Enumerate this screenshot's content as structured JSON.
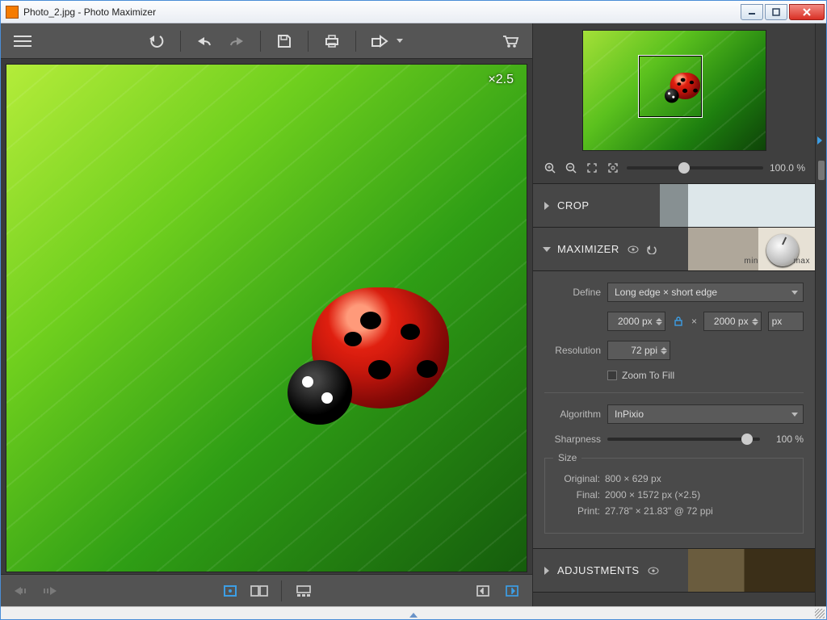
{
  "window": {
    "title": "Photo_2.jpg - Photo Maximizer"
  },
  "canvas": {
    "zoom_label": "×2.5"
  },
  "navigator": {
    "zoom_pct": "100.0 %"
  },
  "panels": {
    "crop": {
      "title": "CROP"
    },
    "maximizer": {
      "title": "MAXIMIZER",
      "min_label": "min",
      "max_label": "max",
      "define_label": "Define",
      "define_value": "Long edge × short edge",
      "dim_w": "2000 px",
      "dim_sep": "×",
      "dim_h": "2000 px",
      "unit": "px",
      "resolution_label": "Resolution",
      "resolution_value": "72 ppi",
      "zoom_to_fill_label": "Zoom To Fill",
      "algorithm_label": "Algorithm",
      "algorithm_value": "InPixio",
      "sharpness_label": "Sharpness",
      "sharpness_value": "100 %",
      "size_legend": "Size",
      "size_original_k": "Original:",
      "size_original_v": "800 × 629 px",
      "size_final_k": "Final:",
      "size_final_v": "2000 × 1572 px (×2.5)",
      "size_print_k": "Print:",
      "size_print_v": "27.78\" × 21.83\" @ 72 ppi"
    },
    "adjustments": {
      "title": "ADJUSTMENTS"
    }
  }
}
